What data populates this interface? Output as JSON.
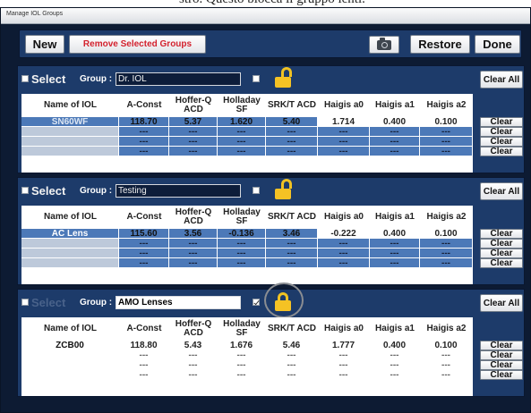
{
  "caption_fragment": "stro. Questo blocca il gruppo lenti.",
  "window": {
    "title": "Manage IOL Groups"
  },
  "toolbar": {
    "new_label": "New",
    "remove_label": "Remove Selected Groups",
    "restore_label": "Restore",
    "done_label": "Done"
  },
  "columns": [
    "Name of IOL",
    "A-Const",
    "Hoffer-Q ACD",
    "Holladay SF",
    "SRK/T ACD",
    "Haigis a0",
    "Haigis a1",
    "Haigis a2"
  ],
  "empty_value": "---",
  "groups": [
    {
      "select_label": "Select",
      "group_label": "Group :",
      "name": "Dr. IOL",
      "locked": false,
      "clear_all_label": "Clear All",
      "rows": [
        {
          "name": "SN60WF",
          "values": [
            "118.70",
            "5.37",
            "1.620",
            "5.40",
            "1.714",
            "0.400",
            "0.100"
          ],
          "clear_label": "Clear"
        },
        {
          "name": "",
          "values": [
            "---",
            "---",
            "---",
            "---",
            "---",
            "---",
            "---"
          ],
          "clear_label": "Clear"
        },
        {
          "name": "",
          "values": [
            "---",
            "---",
            "---",
            "---",
            "---",
            "---",
            "---"
          ],
          "clear_label": "Clear"
        },
        {
          "name": "",
          "values": [
            "---",
            "---",
            "---",
            "---",
            "---",
            "---",
            "---"
          ],
          "clear_label": "Clear"
        }
      ]
    },
    {
      "select_label": "Select",
      "group_label": "Group :",
      "name": "Testing",
      "locked": false,
      "clear_all_label": "Clear All",
      "rows": [
        {
          "name": "AC Lens",
          "values": [
            "115.60",
            "3.56",
            "-0.136",
            "3.46",
            "-0.222",
            "0.400",
            "0.100"
          ],
          "clear_label": "Clear"
        },
        {
          "name": "",
          "values": [
            "---",
            "---",
            "---",
            "---",
            "---",
            "---",
            "---"
          ],
          "clear_label": "Clear"
        },
        {
          "name": "",
          "values": [
            "---",
            "---",
            "---",
            "---",
            "---",
            "---",
            "---"
          ],
          "clear_label": "Clear"
        },
        {
          "name": "",
          "values": [
            "---",
            "---",
            "---",
            "---",
            "---",
            "---",
            "---"
          ],
          "clear_label": "Clear"
        }
      ]
    },
    {
      "select_label": "Select",
      "group_label": "Group :",
      "name": "AMO Lenses",
      "locked": true,
      "clear_all_label": "Clear All",
      "rows": [
        {
          "name": "ZCB00",
          "values": [
            "118.80",
            "5.43",
            "1.676",
            "5.46",
            "1.777",
            "0.400",
            "0.100"
          ],
          "clear_label": "Clear"
        },
        {
          "name": "",
          "values": [
            "---",
            "---",
            "---",
            "---",
            "---",
            "---",
            "---"
          ],
          "clear_label": "Clear"
        },
        {
          "name": "",
          "values": [
            "---",
            "---",
            "---",
            "---",
            "---",
            "---",
            "---"
          ],
          "clear_label": "Clear"
        },
        {
          "name": "",
          "values": [
            "---",
            "---",
            "---",
            "---",
            "---",
            "---",
            "---"
          ],
          "clear_label": "Clear"
        }
      ]
    }
  ],
  "colors": {
    "panel": "#1d3b6a",
    "cell_blue": "#4c79b8",
    "lock": "#f5c224",
    "remove_text": "#d3212d"
  }
}
